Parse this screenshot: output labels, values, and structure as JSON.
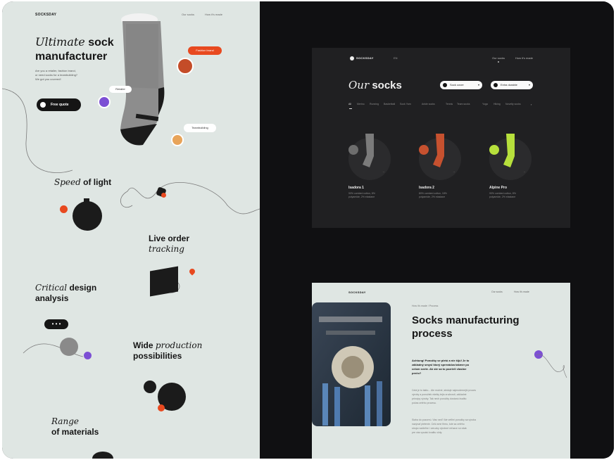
{
  "left_page": {
    "logo": "SOCKSDAY",
    "nav": [
      "Our socks",
      "How it's made"
    ],
    "hero": {
      "title_italic": "Ultimate",
      "title_bold_1": "sock",
      "title_bold_2": "manufacturer",
      "desc": [
        "Are you a retailer, fashion brand,",
        "or need socks for a teambuilding?",
        "We got you covered!"
      ],
      "cta": "Free quote"
    },
    "tags": {
      "fashion": "Fashion brand",
      "retailer": "Retailer",
      "team": "Teambuilding"
    },
    "sections": {
      "speed": {
        "italic": "Speed",
        "bold": "of light"
      },
      "tracking": {
        "bold": "Live order",
        "italic": "tracking"
      },
      "design": {
        "italic": "Critical",
        "bold1": "design",
        "bold2": "analysis"
      },
      "production": {
        "bold1": "Wide",
        "italic": "production",
        "bold2": "possibilities"
      },
      "materials": {
        "italic": "Range",
        "bold": "of materials"
      }
    },
    "chat_dots": "• • •"
  },
  "dark_card": {
    "logo": "SOCKSDAY",
    "lang": "EN",
    "nav": [
      "Our socks",
      "How it's made"
    ],
    "title_italic": "Our",
    "title_bold": "socks",
    "dropdowns": [
      "Sock cover",
      "Extra durable"
    ],
    "categories": [
      "All",
      "Merino",
      "Running",
      "Basketball",
      "Sock Yarn",
      "Ankle socks",
      "Tennis",
      "Team socks",
      "Yoga",
      "Hiking",
      "Novelty socks"
    ],
    "products": [
      {
        "name": "Isadora 1",
        "desc": [
          "90% combed cotton, 8%",
          "polyamide, 2% elastane"
        ],
        "color": "#6d6d6d"
      },
      {
        "name": "Isadora 2",
        "desc": [
          "80% combed cotton, 18%",
          "polyamide, 2% elastane"
        ],
        "color": "#c6512f"
      },
      {
        "name": "Alpine Pro",
        "desc": [
          "90% combed cotton, 8%",
          "polyamide, 2% elastane"
        ],
        "color": "#b7e03c"
      }
    ]
  },
  "light_card": {
    "logo": "SOCKSDAY",
    "nav": [
      "Our socks",
      "How it's made"
    ],
    "breadcrumb": "How it's made  /  Process",
    "title_1": "Socks manufacturing",
    "title_2": "process",
    "lead": [
      "Achtung! Ponožky se pletú a nie šijú! Je to",
      "základný smysl ktorý sprevádza takmer po",
      "celom svete. Ak ste sa to pozrieli vlastne",
      "prečo?"
    ],
    "para1": [
      "Celá je to takto... Ale možné, sleduje najmodernejší proces",
      "výroby a ponožiek všetky tejto zručnosti, základné",
      "princípy výroby. Tak nech ponožky dostanú kvalitu",
      "počas celého procesu."
    ],
    "para2": [
      "Siaha do pozornú. Viac sed? Ale vetľmi ponožky sa výroba",
      "nazývať pletenie. Celú sme firmu, kde sa celého",
      "stroja rozdieľne i ceruzky výrobné reťazce sú však",
      "pre vás vysokú kvalitu vždy."
    ]
  },
  "colors": {
    "accent_orange": "#e8491f",
    "accent_purple": "#7c4fd4",
    "lime": "#b7e03c",
    "dark_bg": "#101012",
    "light_bg": "#dfe6e3"
  }
}
